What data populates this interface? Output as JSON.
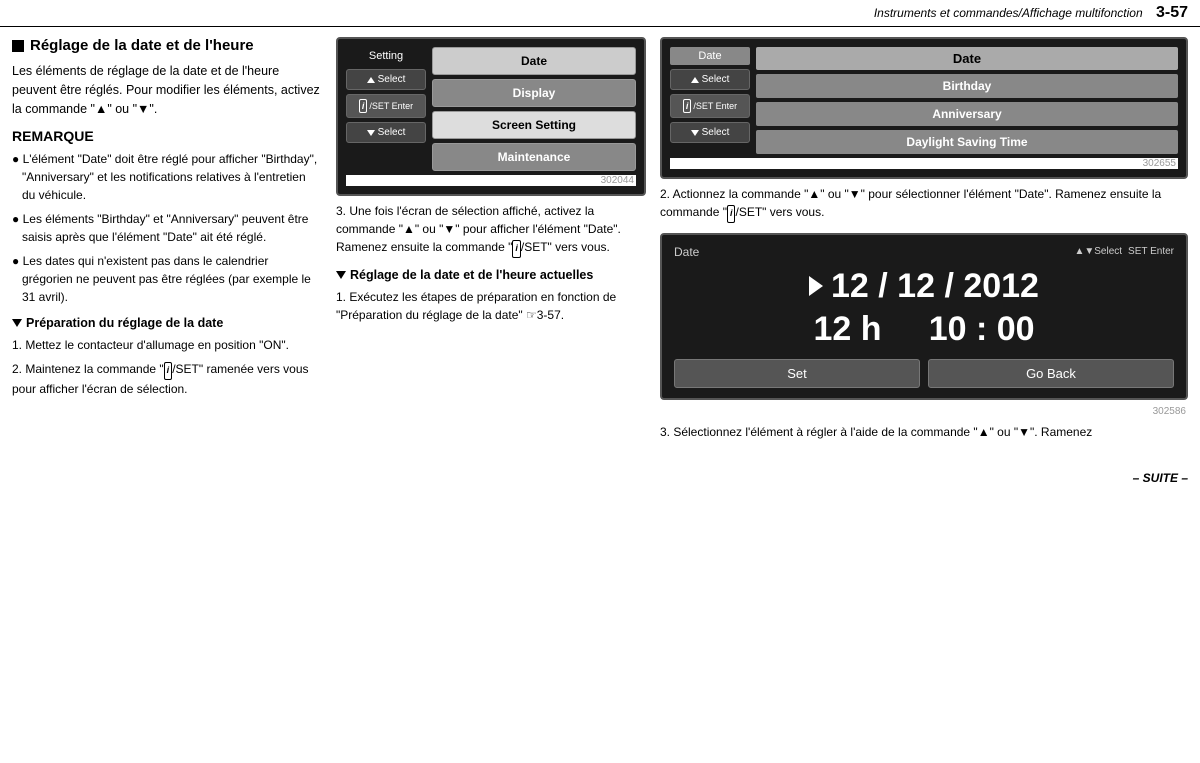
{
  "header": {
    "section": "Instruments et commandes/Affichage multifonction",
    "page_num": "3-57"
  },
  "left": {
    "title": "Réglage de la date et de l'heure",
    "intro": "Les éléments de réglage de la date et de l'heure peuvent être réglés. Pour modifier les éléments, activez la commande \"▲\" ou \"▼\".",
    "remarque_title": "REMARQUE",
    "remarque_items": [
      "L'élément \"Date\" doit être réglé pour afficher \"Birthday\", \"Anniversary\" et les notifications relatives à l'entretien du véhicule.",
      "Les éléments \"Birthday\" et \"Anniversary\" peuvent être saisis après que l'élément \"Date\" ait été réglé.",
      "Les dates qui n'existent pas dans le calendrier grégorien ne peuvent pas être réglées (par exemple le 31 avril)."
    ],
    "prep_title": "Préparation du réglage de la date",
    "step1": "1. Mettez le contacteur d'allumage en position \"ON\".",
    "step2": "2. Maintenez la commande \"i/SET\" ramenée vers vous pour afficher l'écran de sélection."
  },
  "mid": {
    "screen1": {
      "label": "Setting",
      "btn_select_up": "▲ Select",
      "btn_enter": "Enter",
      "btn_select_down": "▼ Select",
      "items": [
        "Date",
        "Display",
        "Screen Setting",
        "Maintenance"
      ],
      "code": "302044"
    },
    "caption1": "3. Une fois l'écran de sélection affiché, activez la commande \"▲\" ou \"▼\" pour afficher l'élément \"Date\". Ramenez ensuite la commande \"i/SET\" vers vous.",
    "sub_title": "Réglage de la date et de l'heure actuelles",
    "sub_step1": "1. Exécutez les étapes de préparation en fonction de \"Préparation du réglage de la date\" ☞3-57."
  },
  "right": {
    "screen1": {
      "header_label": "Date",
      "title": "Date",
      "btn_select_up": "▲ Select",
      "btn_enter": "Enter",
      "btn_select_down": "▼ Select",
      "items": [
        "Birthday",
        "Anniversary",
        "Daylight Saving Time"
      ],
      "code": "302655"
    },
    "caption1": "2. Actionnez la commande \"▲\" ou \"▼\" pour sélectionner l'élément \"Date\". Ramenez ensuite la commande \"i/SET\" vers vous.",
    "screen2": {
      "header_left": "Date",
      "header_select": "▲▼Select",
      "header_enter": "SET Enter",
      "date_big": "▶ 12 / 12 / 2012",
      "time_big": "12 h      10 : 00",
      "btn_set": "Set",
      "btn_go_back": "Go Back",
      "code": "302586"
    },
    "caption2": "3. Sélectionnez l'élément à régler à l'aide de la commande \"▲\" ou \"▼\". Ramenez"
  },
  "footer": {
    "text": "– SUITE –"
  }
}
